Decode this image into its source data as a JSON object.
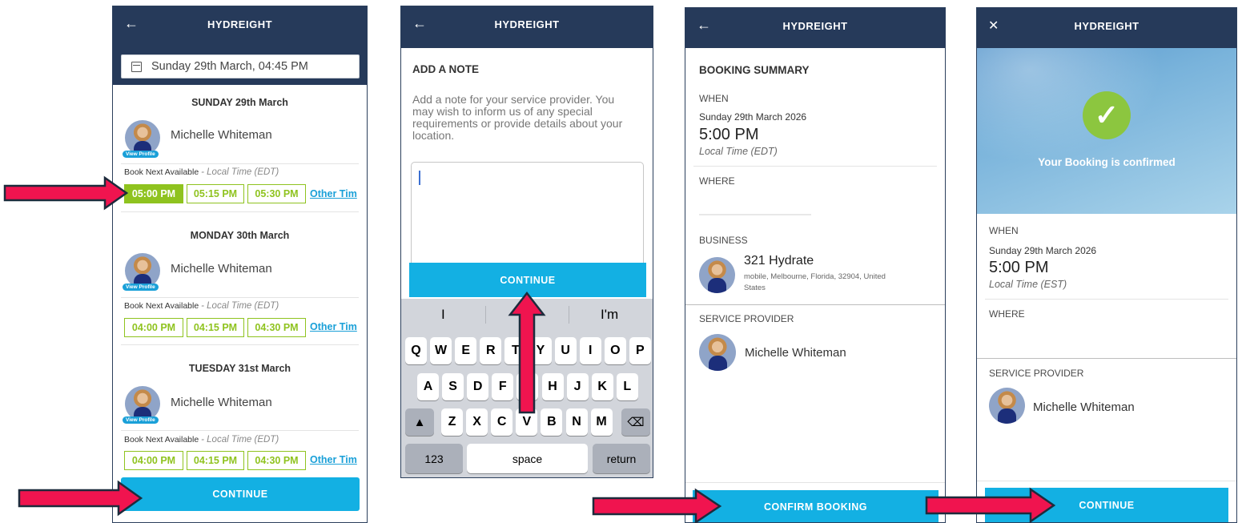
{
  "app": {
    "logo": "HYDREIGHT",
    "back_glyph": "←",
    "close_glyph": "✕"
  },
  "screen1": {
    "date_field": "Sunday 29th March, 04:45 PM",
    "days": [
      {
        "heading": "SUNDAY 29th March",
        "provider": "Michelle Whiteman",
        "view_profile": "View Profile",
        "book_label": "Book Next Available",
        "tz": "- Local Time (EDT)",
        "slots": [
          "05:00 PM",
          "05:15 PM",
          "05:30 PM"
        ],
        "selected_index": 0,
        "other": "Other Tim"
      },
      {
        "heading": "MONDAY 30th March",
        "provider": "Michelle Whiteman",
        "view_profile": "View Profile",
        "book_label": "Book Next Available",
        "tz": "- Local Time (EDT)",
        "slots": [
          "04:00 PM",
          "04:15 PM",
          "04:30 PM"
        ],
        "selected_index": -1,
        "other": "Other Tim"
      },
      {
        "heading": "TUESDAY 31st March",
        "provider": "Michelle Whiteman",
        "view_profile": "View Profile",
        "book_label": "Book Next Available",
        "tz": "- Local Time (EDT)",
        "slots": [
          "04:00 PM",
          "04:15 PM",
          "04:30 PM"
        ],
        "selected_index": -1,
        "other": "Other Tim"
      }
    ],
    "continue_label": "CONTINUE"
  },
  "screen2": {
    "title": "ADD A NOTE",
    "description": "Add a note for your service provider. You may wish to inform us of any special requirements or provide details about your location.",
    "note_value": "",
    "continue_label": "CONTINUE",
    "suggestions": [
      "I",
      "",
      "I'm"
    ],
    "rows": [
      [
        "Q",
        "W",
        "E",
        "R",
        "T",
        "Y",
        "U",
        "I",
        "O",
        "P"
      ],
      [
        "A",
        "S",
        "D",
        "F",
        "G",
        "H",
        "J",
        "K",
        "L"
      ],
      [
        "Z",
        "X",
        "C",
        "V",
        "B",
        "N",
        "M"
      ]
    ],
    "key_123": "123",
    "key_space": "space",
    "key_return": "return"
  },
  "screen3": {
    "title": "BOOKING SUMMARY",
    "when_label": "WHEN",
    "when_date": "Sunday 29th March 2026",
    "when_time": "5:00 PM",
    "when_tz": "Local Time (EDT)",
    "where_label": "WHERE",
    "business_label": "BUSINESS",
    "business_name": "321 Hydrate",
    "business_address": "mobile, Melbourne, Florida, 32904, United States",
    "provider_label": "SERVICE PROVIDER",
    "provider_name": "Michelle Whiteman",
    "confirm_label": "CONFIRM BOOKING"
  },
  "screen4": {
    "confirmed": "Your Booking is confirmed",
    "when_label": "WHEN",
    "when_date": "Sunday 29th March 2026",
    "when_time": "5:00 PM",
    "when_tz": "Local Time (EST)",
    "where_label": "WHERE",
    "provider_label": "SERVICE PROVIDER",
    "provider_name": "Michelle Whiteman",
    "continue_label": "CONTINUE"
  },
  "colors": {
    "header": "#263a5a",
    "accent": "#13b0e3",
    "slot_green": "#8fc31f",
    "arrow_red": "#f0144f",
    "arrow_outline": "#1d2b3c"
  }
}
